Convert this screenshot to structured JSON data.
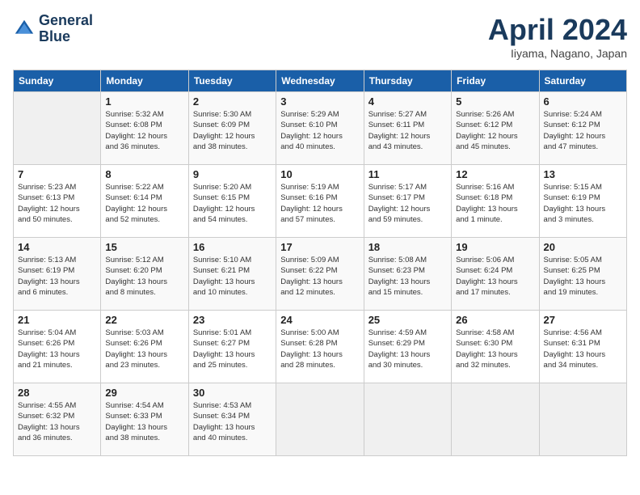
{
  "header": {
    "logo_line1": "General",
    "logo_line2": "Blue",
    "month_title": "April 2024",
    "location": "Iiyama, Nagano, Japan"
  },
  "weekdays": [
    "Sunday",
    "Monday",
    "Tuesday",
    "Wednesday",
    "Thursday",
    "Friday",
    "Saturday"
  ],
  "weeks": [
    [
      {
        "day": "",
        "info": ""
      },
      {
        "day": "1",
        "info": "Sunrise: 5:32 AM\nSunset: 6:08 PM\nDaylight: 12 hours\nand 36 minutes."
      },
      {
        "day": "2",
        "info": "Sunrise: 5:30 AM\nSunset: 6:09 PM\nDaylight: 12 hours\nand 38 minutes."
      },
      {
        "day": "3",
        "info": "Sunrise: 5:29 AM\nSunset: 6:10 PM\nDaylight: 12 hours\nand 40 minutes."
      },
      {
        "day": "4",
        "info": "Sunrise: 5:27 AM\nSunset: 6:11 PM\nDaylight: 12 hours\nand 43 minutes."
      },
      {
        "day": "5",
        "info": "Sunrise: 5:26 AM\nSunset: 6:12 PM\nDaylight: 12 hours\nand 45 minutes."
      },
      {
        "day": "6",
        "info": "Sunrise: 5:24 AM\nSunset: 6:12 PM\nDaylight: 12 hours\nand 47 minutes."
      }
    ],
    [
      {
        "day": "7",
        "info": "Sunrise: 5:23 AM\nSunset: 6:13 PM\nDaylight: 12 hours\nand 50 minutes."
      },
      {
        "day": "8",
        "info": "Sunrise: 5:22 AM\nSunset: 6:14 PM\nDaylight: 12 hours\nand 52 minutes."
      },
      {
        "day": "9",
        "info": "Sunrise: 5:20 AM\nSunset: 6:15 PM\nDaylight: 12 hours\nand 54 minutes."
      },
      {
        "day": "10",
        "info": "Sunrise: 5:19 AM\nSunset: 6:16 PM\nDaylight: 12 hours\nand 57 minutes."
      },
      {
        "day": "11",
        "info": "Sunrise: 5:17 AM\nSunset: 6:17 PM\nDaylight: 12 hours\nand 59 minutes."
      },
      {
        "day": "12",
        "info": "Sunrise: 5:16 AM\nSunset: 6:18 PM\nDaylight: 13 hours\nand 1 minute."
      },
      {
        "day": "13",
        "info": "Sunrise: 5:15 AM\nSunset: 6:19 PM\nDaylight: 13 hours\nand 3 minutes."
      }
    ],
    [
      {
        "day": "14",
        "info": "Sunrise: 5:13 AM\nSunset: 6:19 PM\nDaylight: 13 hours\nand 6 minutes."
      },
      {
        "day": "15",
        "info": "Sunrise: 5:12 AM\nSunset: 6:20 PM\nDaylight: 13 hours\nand 8 minutes."
      },
      {
        "day": "16",
        "info": "Sunrise: 5:10 AM\nSunset: 6:21 PM\nDaylight: 13 hours\nand 10 minutes."
      },
      {
        "day": "17",
        "info": "Sunrise: 5:09 AM\nSunset: 6:22 PM\nDaylight: 13 hours\nand 12 minutes."
      },
      {
        "day": "18",
        "info": "Sunrise: 5:08 AM\nSunset: 6:23 PM\nDaylight: 13 hours\nand 15 minutes."
      },
      {
        "day": "19",
        "info": "Sunrise: 5:06 AM\nSunset: 6:24 PM\nDaylight: 13 hours\nand 17 minutes."
      },
      {
        "day": "20",
        "info": "Sunrise: 5:05 AM\nSunset: 6:25 PM\nDaylight: 13 hours\nand 19 minutes."
      }
    ],
    [
      {
        "day": "21",
        "info": "Sunrise: 5:04 AM\nSunset: 6:26 PM\nDaylight: 13 hours\nand 21 minutes."
      },
      {
        "day": "22",
        "info": "Sunrise: 5:03 AM\nSunset: 6:26 PM\nDaylight: 13 hours\nand 23 minutes."
      },
      {
        "day": "23",
        "info": "Sunrise: 5:01 AM\nSunset: 6:27 PM\nDaylight: 13 hours\nand 25 minutes."
      },
      {
        "day": "24",
        "info": "Sunrise: 5:00 AM\nSunset: 6:28 PM\nDaylight: 13 hours\nand 28 minutes."
      },
      {
        "day": "25",
        "info": "Sunrise: 4:59 AM\nSunset: 6:29 PM\nDaylight: 13 hours\nand 30 minutes."
      },
      {
        "day": "26",
        "info": "Sunrise: 4:58 AM\nSunset: 6:30 PM\nDaylight: 13 hours\nand 32 minutes."
      },
      {
        "day": "27",
        "info": "Sunrise: 4:56 AM\nSunset: 6:31 PM\nDaylight: 13 hours\nand 34 minutes."
      }
    ],
    [
      {
        "day": "28",
        "info": "Sunrise: 4:55 AM\nSunset: 6:32 PM\nDaylight: 13 hours\nand 36 minutes."
      },
      {
        "day": "29",
        "info": "Sunrise: 4:54 AM\nSunset: 6:33 PM\nDaylight: 13 hours\nand 38 minutes."
      },
      {
        "day": "30",
        "info": "Sunrise: 4:53 AM\nSunset: 6:34 PM\nDaylight: 13 hours\nand 40 minutes."
      },
      {
        "day": "",
        "info": ""
      },
      {
        "day": "",
        "info": ""
      },
      {
        "day": "",
        "info": ""
      },
      {
        "day": "",
        "info": ""
      }
    ]
  ]
}
